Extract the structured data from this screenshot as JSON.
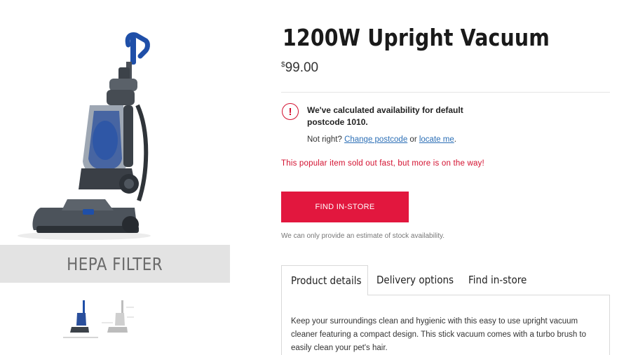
{
  "product": {
    "title": "1200W Upright Vacuum",
    "price_currency": "$",
    "price_amount": "99.00",
    "banner_text": "HEPA FILTER"
  },
  "availability": {
    "message": "We've calculated availability for default postcode 1010.",
    "not_right_text": "Not right?",
    "change_postcode_link": "Change postcode",
    "or_text": "or",
    "locate_me_link": "locate me",
    "period": ".",
    "soldout_message": "This popular item sold out fast, but more is on the way!"
  },
  "actions": {
    "find_in_store_label": "FIND IN-STORE",
    "estimate_note": "We can only provide an estimate of stock availability."
  },
  "tabs": [
    {
      "label": "Product details"
    },
    {
      "label": "Delivery options"
    },
    {
      "label": "Find in-store"
    }
  ],
  "description": "Keep your surroundings clean and hygienic with this easy to use upright vacuum cleaner featuring a compact design. This stick vacuum comes with a turbo brush to easily clean your pet's hair.",
  "colors": {
    "accent_red": "#e2173e",
    "alert_red": "#d3102f",
    "link_blue": "#2c6fb6",
    "vacuum_blue": "#1f4fa8"
  },
  "icons": {
    "alert": "exclamation-circle-icon"
  }
}
